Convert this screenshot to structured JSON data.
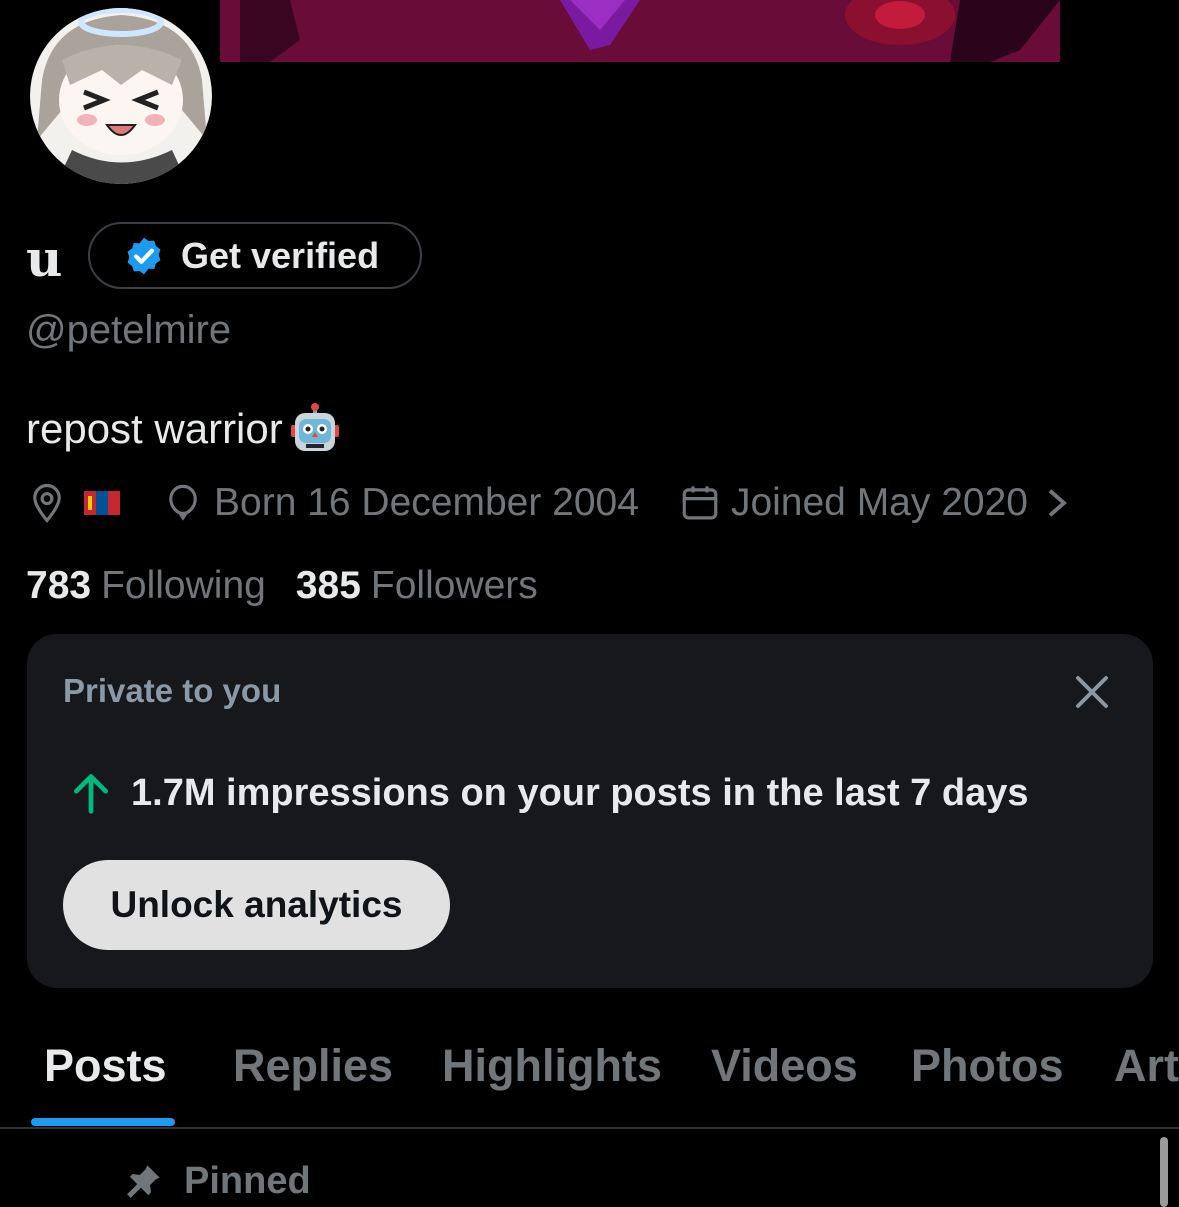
{
  "profile": {
    "name": "u",
    "verify_label": "Get verified",
    "handle": "@petelmire",
    "bio": "repost warrior",
    "born": "Born 16 December 2004",
    "joined": "Joined May 2020",
    "following_count": "783",
    "following_label": "Following",
    "followers_count": "385",
    "followers_label": "Followers"
  },
  "private_card": {
    "title": "Private to you",
    "stat": "1.7M impressions on your posts in the last 7 days",
    "button": "Unlock analytics"
  },
  "tabs": [
    "Posts",
    "Replies",
    "Highlights",
    "Videos",
    "Photos",
    "Art"
  ],
  "pinned_label": "Pinned",
  "colors": {
    "background": "#000000",
    "accent": "#1d9bf0",
    "positive": "#00ba7c",
    "muted": "#71767b",
    "card": "#16181c"
  },
  "icons": {
    "location": "location-pin-icon",
    "flag": "mongolia-flag-icon",
    "birthday": "balloon-icon",
    "joined": "calendar-icon",
    "verified": "verified-badge-icon",
    "close": "close-icon",
    "trend": "arrow-up-icon",
    "pinned": "pin-icon"
  }
}
